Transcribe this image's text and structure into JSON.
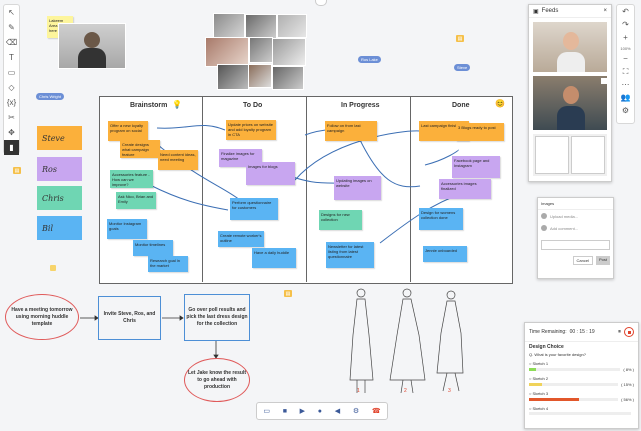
{
  "left_toolbar": [
    {
      "name": "select-tool-icon",
      "glyph": "↖"
    },
    {
      "name": "pen-tool-icon",
      "glyph": "✎"
    },
    {
      "name": "eraser-tool-icon",
      "glyph": "⌫"
    },
    {
      "name": "text-tool-icon",
      "glyph": "T"
    },
    {
      "name": "sticky-note-tool-icon",
      "glyph": "▭"
    },
    {
      "name": "shapes-tool-icon",
      "glyph": "◇"
    },
    {
      "name": "formula-tool-icon",
      "glyph": "{x}"
    },
    {
      "name": "cut-tool-icon",
      "glyph": "✂"
    },
    {
      "name": "move-tool-icon",
      "glyph": "✥"
    },
    {
      "name": "board-tool-icon",
      "glyph": "▮"
    }
  ],
  "right_toolbar": {
    "undo": "↶",
    "redo": "↷",
    "zoom_in": "+",
    "zoom_level": "100%",
    "zoom_out": "−",
    "fit": "⛶",
    "more": "⋯",
    "users": "👥",
    "settings": "⚙"
  },
  "top_note": "Lakeem Area to Be here",
  "cursors": [
    "Chris Wright",
    "Ros Lake",
    "Steve",
    "Ben Rooney"
  ],
  "big_stickies": [
    "Steve",
    "Ros",
    "Chris",
    "Bil"
  ],
  "kanban": {
    "columns": [
      "Brainstorm",
      "To Do",
      "In Progress",
      "Done"
    ],
    "brainstorm_notes": [
      "Offer a new loyalty program on social",
      "Create designs what campaign feature",
      "Need content ideas, need meeting",
      "Accessories feature - How can we improve?",
      "Ask Nico, Brian and Emily",
      "Monitor Instagram goals",
      "Monitor timelines",
      "Research goal in the market"
    ],
    "todo_notes": [
      "Update prices on website and add loyalty program in CTA",
      "Finalize images for magazine",
      "Images for blogs",
      "Perform questionnaire for customers",
      "Create remote worker's outline",
      "Have a daily huddle"
    ],
    "inprogress_notes": [
      "Follow on from last campaign",
      "Updating images on website",
      "Designs for new collection",
      "Newsletter for latest listing from latest questionnaire"
    ],
    "done_notes": [
      "Last campaign finished",
      "3 Blogs ready to post",
      "Facebook page and Instagram",
      "Accessories images finalized",
      "Design for womens collection done",
      "Jennie onboarded"
    ]
  },
  "flowchart": {
    "start": "Have a meeting tomorrow using morning huddle template",
    "step2": "Invite Steve, Ros, and Chris",
    "step3": "Go over poll results and pick the last dress design for the collection",
    "step4": "Let Jake know the result to go ahead with production"
  },
  "sketch_numbers": [
    "1",
    "2",
    "3"
  ],
  "feeds": {
    "title": "Feeds",
    "close": "×"
  },
  "images_panel": {
    "title": "Images",
    "rows": [
      "Upload media...",
      "Add comment..."
    ],
    "buttons": [
      "Cancel",
      "Post"
    ]
  },
  "poll": {
    "timer_label": "Time Remaining:",
    "timer_value": "00 : 15 : 19",
    "title": "Design Choice",
    "question": "Q.  What is your favorite design?",
    "options": [
      {
        "label": "Sketch 1",
        "percent": "( 8% )",
        "fill": 0.08,
        "color": "#8ddc57"
      },
      {
        "label": "Sketch 2",
        "percent": "( 15% )",
        "fill": 0.15,
        "color": "#f0d35a"
      },
      {
        "label": "Sketch 3",
        "percent": "( 56% )",
        "fill": 0.56,
        "color": "#e2572b"
      },
      {
        "label": "Sketch 4",
        "percent": "",
        "fill": 0,
        "color": "#cccccc"
      }
    ]
  },
  "bottom_bar": [
    "screen-share-icon",
    "camera-icon",
    "video-icon",
    "microphone-icon",
    "volume-icon",
    "settings-icon",
    "leave-icon"
  ]
}
